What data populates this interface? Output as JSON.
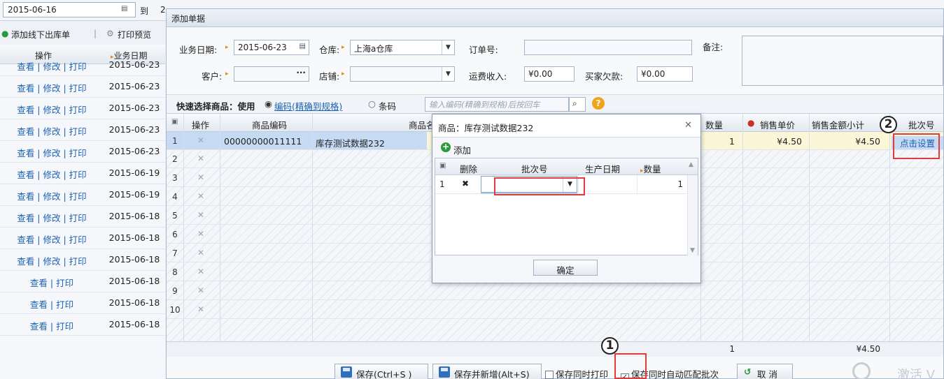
{
  "bg": {
    "date_from": "2015-06-16",
    "to_label": "到",
    "date_to_partial": "2",
    "toolbar": {
      "add_offline": "添加线下出库单",
      "print_preview": "打印预览"
    },
    "columns": {
      "ops": "操作",
      "date": "业务日期"
    },
    "rows": [
      {
        "ops": "查看 | 修改 | 打印",
        "date": "2015-06-23"
      },
      {
        "ops": "查看 | 修改 | 打印",
        "date": "2015-06-23"
      },
      {
        "ops": "查看 | 修改 | 打印",
        "date": "2015-06-23"
      },
      {
        "ops": "查看 | 修改 | 打印",
        "date": "2015-06-23"
      },
      {
        "ops": "查看 | 修改 | 打印",
        "date": "2015-06-23"
      },
      {
        "ops": "查看 | 修改 | 打印",
        "date": "2015-06-19"
      },
      {
        "ops": "查看 | 修改 | 打印",
        "date": "2015-06-19"
      },
      {
        "ops": "查看 | 修改 | 打印",
        "date": "2015-06-18"
      },
      {
        "ops": "查看 | 修改 | 打印",
        "date": "2015-06-18"
      },
      {
        "ops": "查看 | 修改 | 打印",
        "date": "2015-06-18"
      },
      {
        "ops": "查看 | 打印",
        "date": "2015-06-18"
      },
      {
        "ops": "查看 | 打印",
        "date": "2015-06-18"
      },
      {
        "ops": "查看 | 打印",
        "date": "2015-06-18"
      }
    ]
  },
  "form": {
    "title": "添加单据",
    "business_date_label": "业务日期:",
    "business_date": "2015-06-23",
    "warehouse_label": "仓库:",
    "warehouse": "上海a仓库",
    "order_no_label": "订单号:",
    "remark_label": "备注:",
    "customer_label": "客户:",
    "store_label": "店铺:",
    "freight_label": "运费收入:",
    "freight": "¥0.00",
    "buyer_owe_label": "买家欠款:",
    "buyer_owe": "¥0.00",
    "quick_select_label": "快速选择商品：使用",
    "mode_code": "编码(精确到规格)",
    "mode_barcode": "条码",
    "quick_placeholder": "输入编码(精确到规格)后按回车",
    "grid_headers": {
      "ops": "操作",
      "code": "商品编码",
      "name": "商品名",
      "qty": "数量",
      "price": "销售单价",
      "subtotal": "销售金额小计",
      "batch": "批次号"
    },
    "row1": {
      "num": "1",
      "code": "00000000011111",
      "name": "库存测试数据232",
      "qty": "1",
      "price": "¥4.50",
      "subtotal": "¥4.50",
      "batch_link": "点击设置"
    },
    "row_numbers": [
      "2",
      "3",
      "4",
      "5",
      "6",
      "7",
      "8",
      "9",
      "10"
    ],
    "sum_qty": "1",
    "sum_amount": "¥4.50",
    "buttons": {
      "save": "保存(Ctrl+S )",
      "save_new": "保存并新增(Alt+S)",
      "save_print": "保存同时打印",
      "auto_match": "保存同时自动匹配批次",
      "cancel": "取 消"
    },
    "watermark": "激活 V"
  },
  "batch": {
    "title": "商品：库存测试数据232",
    "add": "添加",
    "headers": {
      "del": "删除",
      "batch_no": "批次号",
      "prod_date": "生产日期",
      "qty": "数量"
    },
    "row": {
      "num": "1",
      "qty": "1"
    },
    "confirm": "确定"
  },
  "annotations": {
    "one": "1",
    "two": "2"
  },
  "colors": {
    "link": "#1a62b4",
    "annotation": "#e23b3b",
    "highlight_row": "#fbf6d8",
    "selected_cell": "#c6dbf3"
  }
}
